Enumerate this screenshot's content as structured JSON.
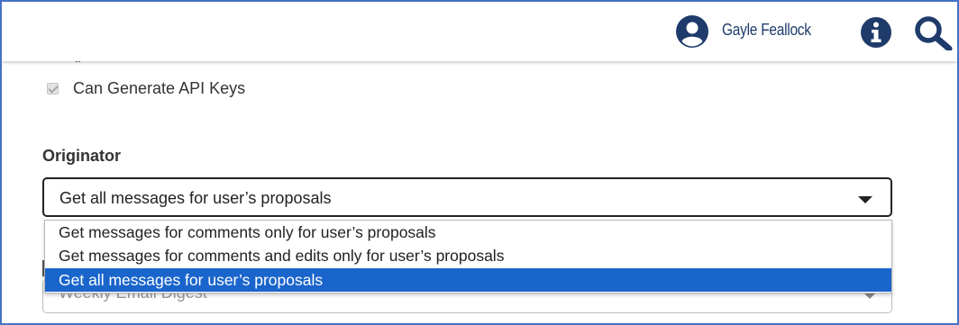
{
  "header": {
    "user_name": "Gayle Feallock",
    "icons": [
      "user-avatar-icon",
      "info-icon",
      "search-icon"
    ]
  },
  "permissions": {
    "partial_label": "y",
    "can_generate_api_keys": {
      "label": "Can Generate API Keys",
      "checked": true,
      "disabled": true
    }
  },
  "originator": {
    "label": "Originator",
    "selected_value": "Get all messages for user’s proposals",
    "options": [
      "Get messages for comments only for user’s proposals",
      "Get messages for comments and edits only for user’s proposals",
      "Get all messages for user’s proposals"
    ],
    "highlighted_index": 2
  },
  "email_digest": {
    "value": "Weekly Email Digest"
  },
  "colors": {
    "frame_border": "#4472c4",
    "header_text": "#1f3b6b",
    "highlight": "#1a65cc"
  }
}
